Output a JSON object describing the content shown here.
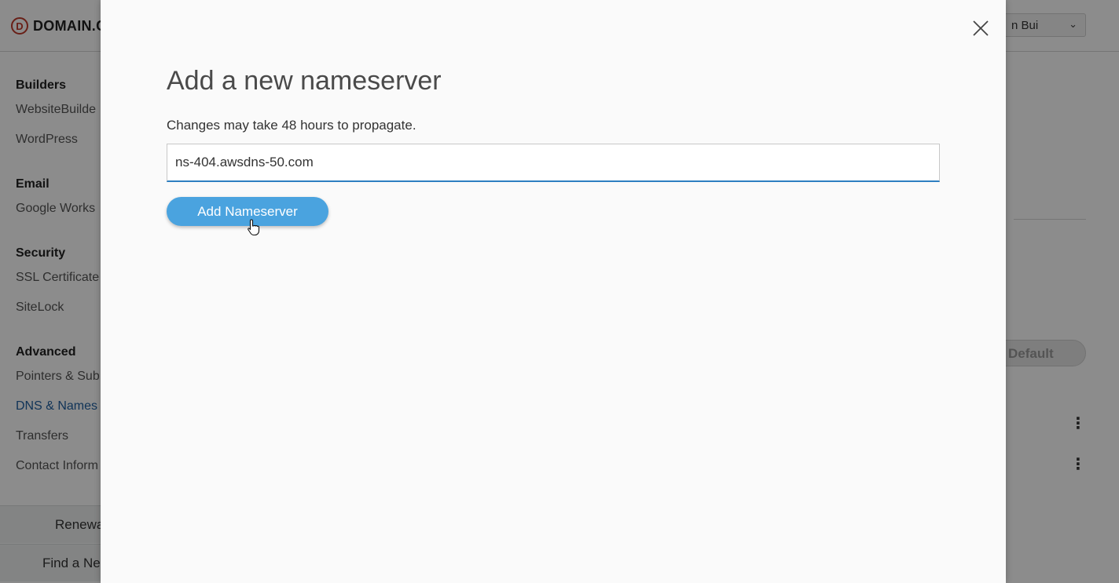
{
  "header": {
    "logo_text": "DOMAIN.C",
    "logo_mark": "D",
    "user_name": "n Bui",
    "user_chevron_icon": "chevron-down-icon"
  },
  "sidebar": {
    "sections": [
      {
        "heading": "Builders",
        "items": [
          "WebsiteBuilde",
          "WordPress"
        ]
      },
      {
        "heading": "Email",
        "items": [
          "Google Works"
        ]
      },
      {
        "heading": "Security",
        "items": [
          "SSL Certificate",
          "SiteLock"
        ]
      },
      {
        "heading": "Advanced",
        "items": [
          "Pointers & Sub",
          "DNS & Names",
          "Transfers",
          "Contact Inform"
        ]
      }
    ],
    "active_item": "DNS & Names",
    "renew_button": "Renewa",
    "find_button": "Find a Ne"
  },
  "main": {
    "default_button": "Default"
  },
  "modal": {
    "title": "Add a new nameserver",
    "subtitle": "Changes may take 48 hours to propagate.",
    "input_value": "ns-404.awsdns-50.com",
    "add_button": "Add Nameserver",
    "close_icon": "close-icon"
  },
  "colors": {
    "accent": "#4aa3df",
    "input_focus": "#2d7fc1",
    "active_nav": "#1f5fa0",
    "logo": "#c0392b"
  }
}
